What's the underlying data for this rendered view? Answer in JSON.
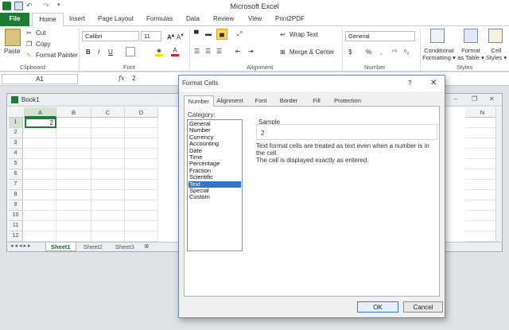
{
  "app": {
    "title": "Microsoft Excel"
  },
  "ribbon": {
    "tabs": [
      "File",
      "Home",
      "Insert",
      "Page Layout",
      "Formulas",
      "Data",
      "Review",
      "View",
      "Print2PDF"
    ],
    "clipboard": {
      "paste": "Paste",
      "cut": "Cut",
      "copy": "Copy",
      "format_painter": "Format Painter",
      "group": "Clipboard"
    },
    "font": {
      "name": "Calibri",
      "size": "11",
      "group": "Font"
    },
    "alignment": {
      "wrap_text": "Wrap Text",
      "merge_center": "Merge & Center",
      "group": "Alignment"
    },
    "number": {
      "format": "General",
      "group": "Number"
    },
    "styles": {
      "conditional": [
        "Conditional",
        "Formatting"
      ],
      "format_table": [
        "Format",
        "as Table"
      ],
      "cell_styles": [
        "Cell",
        "Styles"
      ],
      "group": "Styles"
    }
  },
  "formula_bar": {
    "name_box": "A1",
    "fx": "fx",
    "value": "2"
  },
  "workbook": {
    "title": "Book1",
    "columns": [
      "A",
      "B",
      "C",
      "D",
      "N"
    ],
    "rows": [
      "1",
      "2",
      "3",
      "4",
      "5",
      "6",
      "7",
      "8",
      "9",
      "10",
      "11",
      "12"
    ],
    "a1_value": "2",
    "sheets": [
      "Sheet1",
      "Sheet2",
      "Sheet3"
    ]
  },
  "dialog": {
    "title": "Format Cells",
    "help": "?",
    "tabs": [
      "Number",
      "Alignment",
      "Font",
      "Border",
      "Fill",
      "Protection"
    ],
    "category_label": "Category:",
    "categories": [
      "General",
      "Number",
      "Currency",
      "Accounting",
      "Date",
      "Time",
      "Percentage",
      "Fraction",
      "Scientific",
      "Text",
      "Special",
      "Custom"
    ],
    "selected_category": "Text",
    "sample_label": "Sample",
    "sample_value": "2",
    "description": [
      "Text format cells are treated as text even when a number is in the cell.",
      "The cell is displayed exactly as entered."
    ],
    "ok": "OK",
    "cancel": "Cancel"
  },
  "colors": {
    "accent": "#1e7b34",
    "selection": "#3176c8",
    "file_tab": "#1e7b34"
  }
}
